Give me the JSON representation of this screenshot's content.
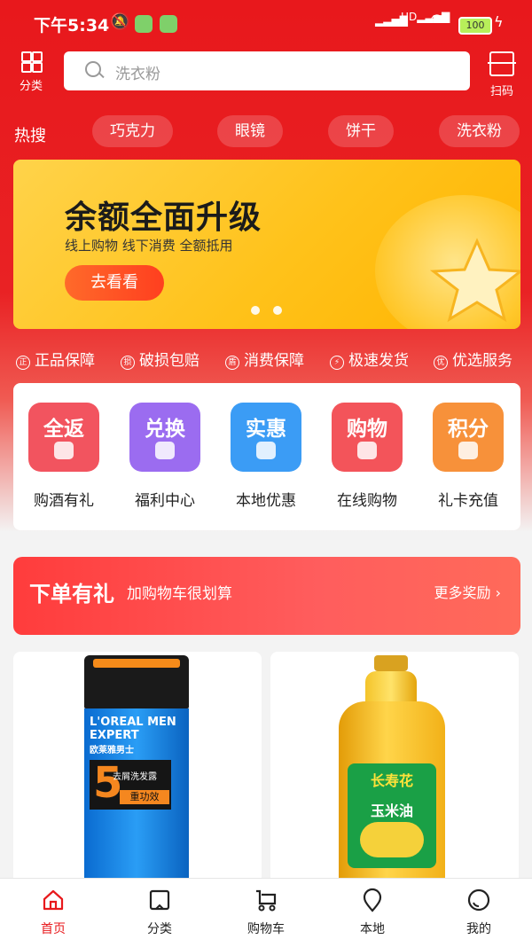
{
  "status_bar": {
    "time": "下午5:34",
    "battery": "100",
    "network": "HD"
  },
  "header": {
    "category_label": "分类",
    "scan_label": "扫码",
    "search_placeholder": "洗衣粉"
  },
  "hot_search": {
    "label": "热搜",
    "chips": [
      "巧克力",
      "眼镜",
      "饼干",
      "洗衣粉"
    ]
  },
  "banner": {
    "title": "余额全面升级",
    "subtitle": "线上购物  线下消费  全额抵用",
    "cta": "去看看",
    "page_count": 2,
    "active_page": 1
  },
  "guarantees": [
    {
      "icon": "正",
      "label": "正品保障"
    },
    {
      "icon": "损",
      "label": "破损包赔"
    },
    {
      "icon": "盾",
      "label": "消费保障"
    },
    {
      "icon": "⚡",
      "label": "极速发货"
    },
    {
      "icon": "优",
      "label": "优选服务"
    }
  ],
  "services": [
    {
      "tile": "全返",
      "label": "购酒有礼",
      "color": "#f2545f"
    },
    {
      "tile": "兑换",
      "label": "福利中心",
      "color": "#9b6cf0"
    },
    {
      "tile": "实惠",
      "label": "本地优惠",
      "color": "#3b9cf5"
    },
    {
      "tile": "购物",
      "label": "在线购物",
      "color": "#f3545a"
    },
    {
      "tile": "积分",
      "label": "礼卡充值",
      "color": "#f7913a"
    }
  ],
  "promo": {
    "title": "下单有礼",
    "subtitle": "加购物车很划算",
    "more": "更多奖励"
  },
  "products": [
    {
      "brand": "L'OREAL MEN EXPERT",
      "brand_cn": "欧莱雅男士",
      "number": "5",
      "tag": "重功效",
      "name": "去屑洗发露"
    },
    {
      "brand": "长寿花",
      "name": "玉米油"
    }
  ],
  "tabbar": {
    "items": [
      {
        "label": "首页",
        "icon": "home-icon",
        "active": true
      },
      {
        "label": "分类",
        "icon": "category-icon",
        "active": false
      },
      {
        "label": "购物车",
        "icon": "cart-icon",
        "active": false
      },
      {
        "label": "本地",
        "icon": "location-icon",
        "active": false
      },
      {
        "label": "我的",
        "icon": "profile-icon",
        "active": false
      }
    ],
    "active_color": "#e8191c"
  },
  "colors": {
    "brand_red": "#e8181c",
    "banner_yellow": "#ffc21a"
  }
}
